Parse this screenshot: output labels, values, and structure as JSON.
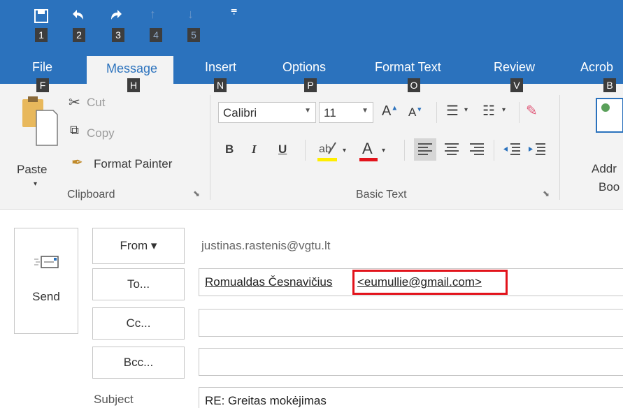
{
  "quick_access": {
    "keytips": [
      "1",
      "2",
      "3",
      "4",
      "5"
    ],
    "icons": [
      "save-icon",
      "undo-icon",
      "redo-icon",
      "up-arrow-icon",
      "down-arrow-icon",
      "customize-icon"
    ]
  },
  "tabs": [
    {
      "label": "File",
      "keytip": "F"
    },
    {
      "label": "Message",
      "keytip": "H",
      "active": true
    },
    {
      "label": "Insert",
      "keytip": "N"
    },
    {
      "label": "Options",
      "keytip": "P"
    },
    {
      "label": "Format Text",
      "keytip": "O"
    },
    {
      "label": "Review",
      "keytip": "V"
    },
    {
      "label": "Acrob",
      "keytip": "B"
    }
  ],
  "clipboard": {
    "paste": "Paste",
    "cut": "Cut",
    "copy": "Copy",
    "format_painter": "Format Painter",
    "label": "Clipboard"
  },
  "basic_text": {
    "font": "Calibri",
    "size": "11",
    "bold": "B",
    "italic": "I",
    "underline": "U",
    "font_color_letter": "A",
    "grow_letter": "A",
    "shrink_letter": "A",
    "label": "Basic Text"
  },
  "names": {
    "address_book_line1": "Addr",
    "address_book_line2": "Boo"
  },
  "compose": {
    "send": "Send",
    "from_label": "From ▾",
    "from_value": "justinas.rastenis@vgtu.lt",
    "to_label": "To...",
    "to_name": "Romualdas Česnavičius",
    "to_email": "<eumullie@gmail.com>",
    "cc_label": "Cc...",
    "bcc_label": "Bcc...",
    "subject_label": "Subject",
    "subject_value": "RE: Greitas mokėjimas"
  },
  "colors": {
    "ribbon_blue": "#2b72bd",
    "highlight_red": "#e2131b",
    "highlighter_yellow": "#ffee00",
    "font_color_red": "#e2131b"
  }
}
